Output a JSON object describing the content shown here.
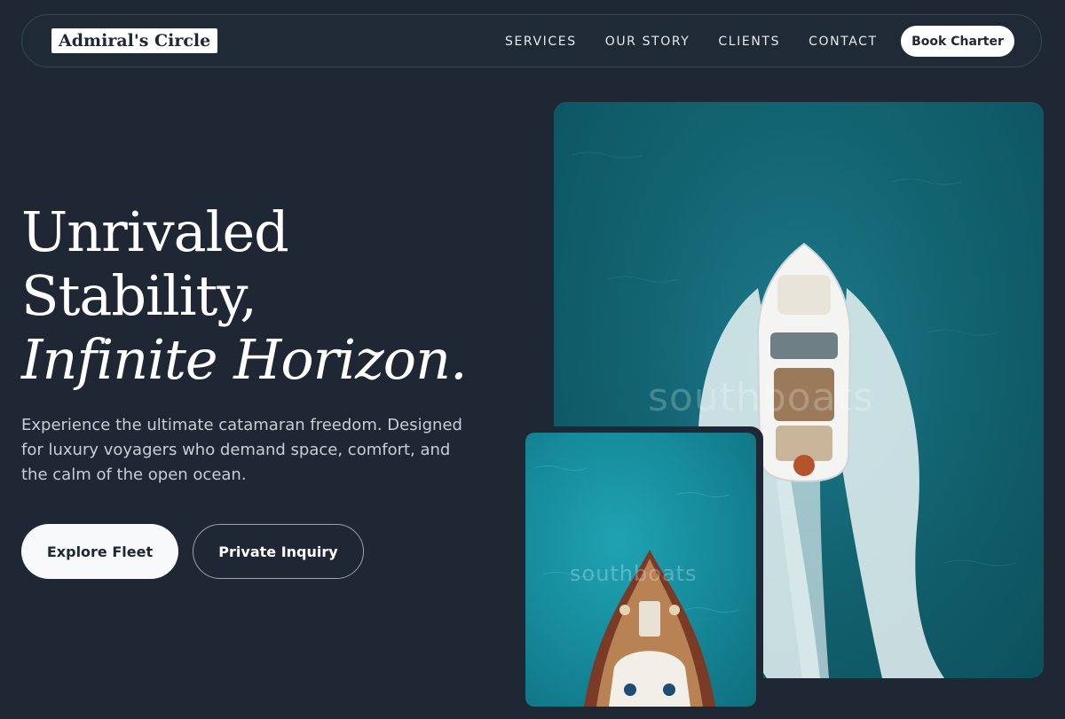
{
  "header": {
    "logo": "Admiral's Circle",
    "nav": [
      "SERVICES",
      "OUR STORY",
      "CLIENTS",
      "CONTACT"
    ],
    "cta": "Book Charter"
  },
  "hero": {
    "title_line1": "Unrivaled",
    "title_line2": "Stability,",
    "title_line3": "Infinite Horizon.",
    "subtitle": "Experience the ultimate catamaran freedom. Designed for luxury voyagers who demand space, comfort, and the calm of the open ocean.",
    "primary_button": "Explore Fleet",
    "secondary_button": "Private Inquiry"
  },
  "images": {
    "main_watermark": "southboats",
    "small_watermark": "southboats"
  }
}
